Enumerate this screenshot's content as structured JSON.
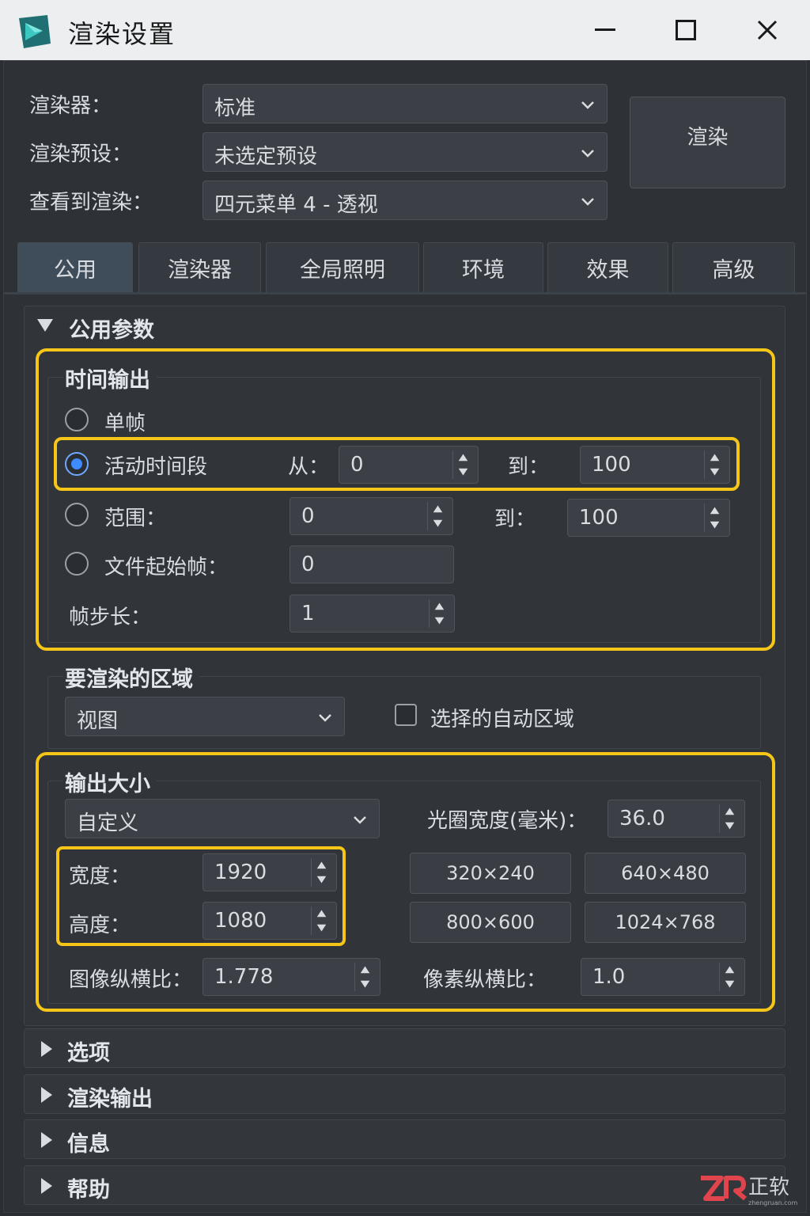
{
  "window": {
    "title": "渲染设置"
  },
  "top": {
    "renderer_label": "渲染器：",
    "renderer_value": "标准",
    "preset_label": "渲染预设：",
    "preset_value": "未选定预设",
    "view_label": "查看到渲染：",
    "view_value": "四元菜单 4 - 透视",
    "render_button": "渲染"
  },
  "tabs": [
    {
      "label": "公用",
      "active": true
    },
    {
      "label": "渲染器"
    },
    {
      "label": "全局照明"
    },
    {
      "label": "环境"
    },
    {
      "label": "效果"
    },
    {
      "label": "高级"
    }
  ],
  "common_params": {
    "header": "公用参数",
    "time_output": {
      "title": "时间输出",
      "single_frame": "单帧",
      "active_segment": "活动时间段",
      "from_label": "从：",
      "from_value": "0",
      "to_label": "到：",
      "to_value": "100",
      "range_label": "范围：",
      "range_from": "0",
      "range_to_label": "到：",
      "range_to": "100",
      "file_start_label": "文件起始帧：",
      "file_start_value": "0",
      "step_label": "帧步长：",
      "step_value": "1",
      "selected_option": "active_segment"
    },
    "area": {
      "title": "要渲染的区域",
      "value": "视图",
      "auto_region_label": "选择的自动区域",
      "auto_region_checked": false
    },
    "output_size": {
      "title": "输出大小",
      "preset_value": "自定义",
      "aperture_label": "光圈宽度(毫米)：",
      "aperture_value": "36.0",
      "width_label": "宽度：",
      "width_value": "1920",
      "height_label": "高度：",
      "height_value": "1080",
      "presets": [
        "320×240",
        "640×480",
        "800×600",
        "1024×768"
      ],
      "aspect_label": "图像纵横比：",
      "aspect_value": "1.778",
      "pixel_aspect_label": "像素纵横比：",
      "pixel_aspect_value": "1.0"
    }
  },
  "rollouts": [
    "选项",
    "渲染输出",
    "信息",
    "帮助"
  ],
  "watermark": {
    "text": "正软",
    "sub": "zhengruan.com"
  },
  "colors": {
    "highlight": "#f5c518",
    "radio_active": "#3d8bff",
    "tab_active": "#3f4c5a"
  }
}
